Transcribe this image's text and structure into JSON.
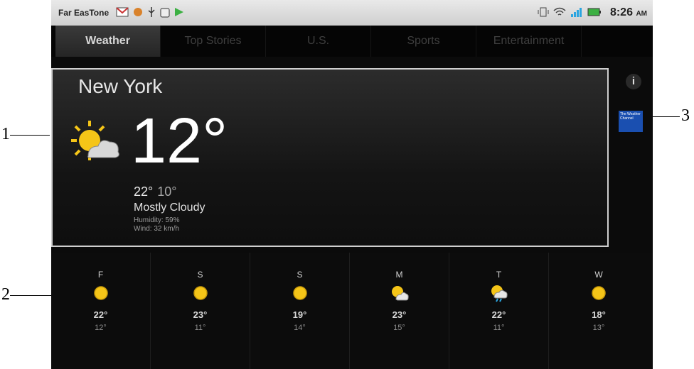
{
  "status_bar": {
    "carrier": "Far EasTone",
    "time": "8:26",
    "ampm": "AM"
  },
  "tabs": [
    {
      "label": "Weather",
      "active": true
    },
    {
      "label": "Top Stories"
    },
    {
      "label": "U.S."
    },
    {
      "label": "Sports"
    },
    {
      "label": "Entertainment"
    }
  ],
  "current": {
    "city": "New York",
    "temp": "12°",
    "high": "22°",
    "low": "10°",
    "condition": "Mostly Cloudy",
    "humidity": "Humidity: 59%",
    "wind": "Wind: 32 km/h",
    "icon": "partly-cloudy-icon"
  },
  "info_label": "i",
  "provider_logo": "The Weather Channel",
  "forecast": [
    {
      "day": "F",
      "hi": "22°",
      "lo": "12°",
      "icon": "sun-icon"
    },
    {
      "day": "S",
      "hi": "23°",
      "lo": "11°",
      "icon": "sun-icon"
    },
    {
      "day": "S",
      "hi": "19°",
      "lo": "14°",
      "icon": "sun-icon"
    },
    {
      "day": "M",
      "hi": "23°",
      "lo": "15°",
      "icon": "partly-cloudy-icon"
    },
    {
      "day": "T",
      "hi": "22°",
      "lo": "11°",
      "icon": "rain-icon"
    },
    {
      "day": "W",
      "hi": "18°",
      "lo": "13°",
      "icon": "sun-icon"
    }
  ],
  "callouts": {
    "one": "1",
    "two": "2",
    "three": "3"
  },
  "colors": {
    "sun": "#f5c518",
    "cloud": "#e6e6e6",
    "logo_bg": "#1a4fb0"
  }
}
